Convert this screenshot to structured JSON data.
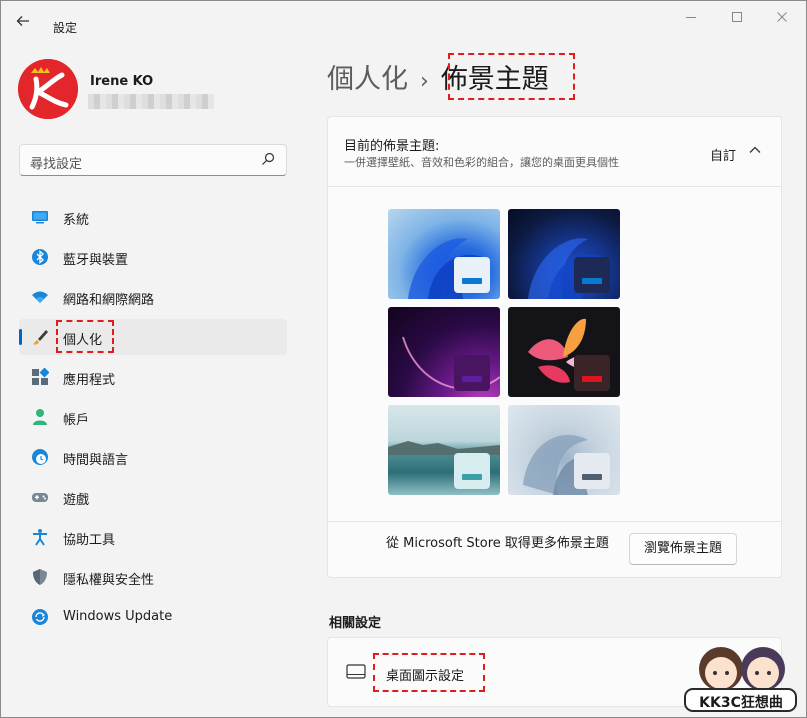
{
  "window": {
    "title": "設定"
  },
  "user": {
    "name": "Irene KO"
  },
  "search": {
    "placeholder": "尋找設定"
  },
  "sidebar": {
    "items": [
      {
        "label": "系統",
        "icon": "monitor-icon"
      },
      {
        "label": "藍牙與裝置",
        "icon": "bluetooth-icon"
      },
      {
        "label": "網路和網際網路",
        "icon": "wifi-icon"
      },
      {
        "label": "個人化",
        "icon": "brush-icon",
        "active": true
      },
      {
        "label": "應用程式",
        "icon": "apps-icon"
      },
      {
        "label": "帳戶",
        "icon": "person-icon"
      },
      {
        "label": "時間與語言",
        "icon": "clock-globe-icon"
      },
      {
        "label": "遊戲",
        "icon": "gamepad-icon"
      },
      {
        "label": "協助工具",
        "icon": "accessibility-icon"
      },
      {
        "label": "隱私權與安全性",
        "icon": "shield-icon"
      },
      {
        "label": "Windows Update",
        "icon": "windows-update-icon"
      }
    ]
  },
  "breadcrumb": {
    "parent": "個人化",
    "separator": "›",
    "current": "佈景主題"
  },
  "theme_card": {
    "title": "目前的佈景主題:",
    "description": "一併選擇壁紙、音效和色彩的組合，讓您的桌面更具個性",
    "value": "自訂",
    "themes": [
      {
        "name": "windows-light",
        "accent": "#0a79d4"
      },
      {
        "name": "windows-dark",
        "accent": "#0a79d4"
      },
      {
        "name": "glow",
        "accent": "#5b1fa0"
      },
      {
        "name": "captured-motion",
        "accent": "#e0141e"
      },
      {
        "name": "sunrise",
        "accent": "#3aa0a8"
      },
      {
        "name": "flow",
        "accent": "#506070"
      }
    ]
  },
  "store_row": {
    "text": "從 Microsoft Store 取得更多佈景主題",
    "button_label": "瀏覽佈景主題"
  },
  "related": {
    "heading": "相關設定",
    "desktop_icons_label": "桌面圖示設定"
  },
  "watermark": {
    "text": "KK3C狂想曲"
  },
  "colors": {
    "accent": "#0067c0",
    "highlight_dash": "#e01d1d"
  }
}
